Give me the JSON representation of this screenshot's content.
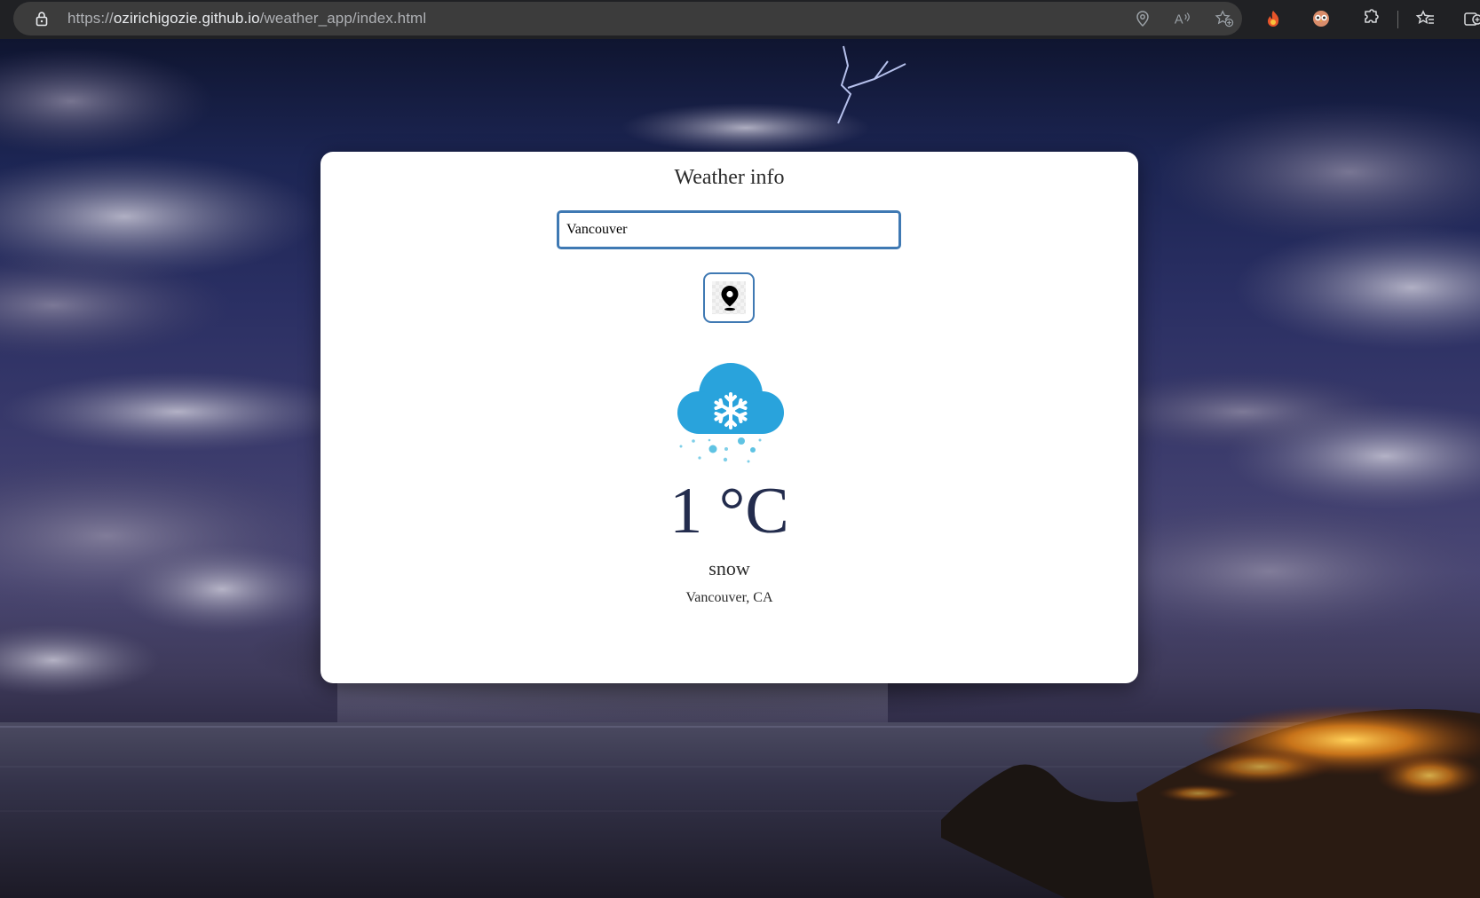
{
  "browser": {
    "url_protocol": "https://",
    "url_host": "ozirichigozie.github.io",
    "url_path": "/weather_app/index.html"
  },
  "card": {
    "title": "Weather info",
    "search_value": "Vancouver",
    "temperature": "1",
    "unit": "°C",
    "condition": "snow",
    "location": "Vancouver, CA"
  },
  "icons": {
    "location_button": "map-pin-icon",
    "weather": "snow-cloud-icon"
  },
  "colors": {
    "accent_border": "#3f79b3",
    "cloud": "#29a3dc",
    "temperature_text": "#232c4d",
    "card_background": "#ffffff"
  }
}
